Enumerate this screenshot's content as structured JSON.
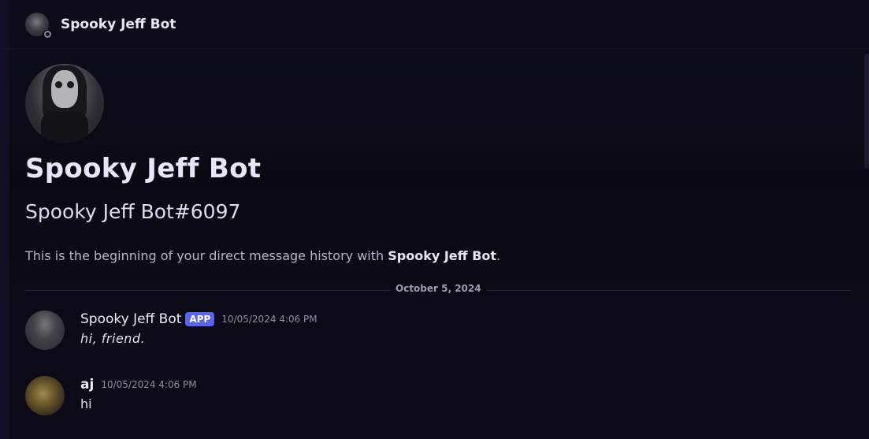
{
  "header": {
    "title": "Spooky Jeff Bot",
    "avatar_icon": "bot-avatar-icon",
    "status_icon": "offline-status-icon"
  },
  "profile": {
    "display_name": "Spooky Jeff Bot",
    "username": "Spooky Jeff Bot#6097",
    "intro_prefix": "This is the beginning of your direct message history with ",
    "intro_name": "Spooky Jeff Bot",
    "intro_suffix": "."
  },
  "divider": {
    "date": "October 5, 2024"
  },
  "messages": [
    {
      "author": "Spooky Jeff Bot",
      "badge": "APP",
      "timestamp": "10/05/2024 4:06 PM",
      "text": "hi, friend."
    },
    {
      "author": "aj",
      "timestamp": "10/05/2024 4:06 PM",
      "text": "hi"
    }
  ],
  "colors": {
    "background": "#0b0a14",
    "app_badge": "#5865f2"
  }
}
